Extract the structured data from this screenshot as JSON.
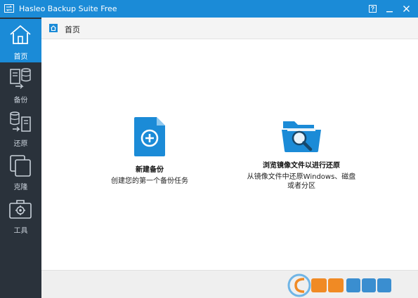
{
  "window": {
    "title": "Hasleo Backup Suite Free",
    "accent_color": "#1b8bd7",
    "buttons": [
      "help-icon",
      "minimize-icon",
      "close-icon"
    ]
  },
  "sidebar": {
    "items": [
      {
        "label": "首页",
        "icon": "home-icon",
        "active": true
      },
      {
        "label": "备份",
        "icon": "backup-icon",
        "active": false
      },
      {
        "label": "还原",
        "icon": "restore-icon",
        "active": false
      },
      {
        "label": "克隆",
        "icon": "clone-icon",
        "active": false
      },
      {
        "label": "工具",
        "icon": "tools-icon",
        "active": false
      }
    ]
  },
  "breadcrumb": {
    "label": "首页",
    "icon": "home-small-icon"
  },
  "main": {
    "cards": [
      {
        "title": "新建备份",
        "description": "创建您的第一个备份任务",
        "icon": "new-backup-file-icon"
      },
      {
        "title": "浏览镜像文件以进行还原",
        "description": "从镜像文件中还原Windows、磁盘或者分区",
        "icon": "browse-image-folder-icon"
      }
    ]
  }
}
